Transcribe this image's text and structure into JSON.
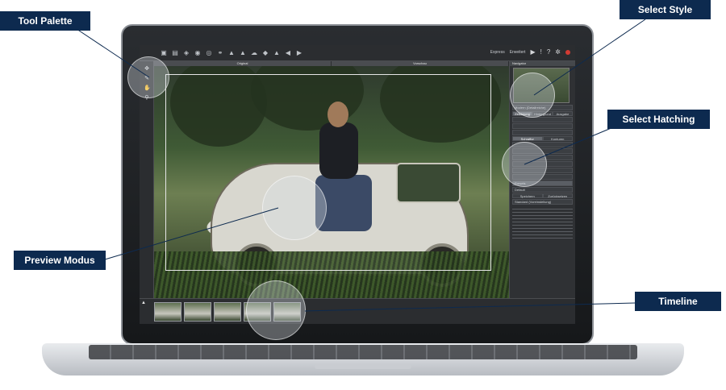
{
  "callouts": {
    "tool_palette": "Tool Palette",
    "select_style": "Select Style",
    "select_hatching": "Select  Hatching",
    "preview_modus": "Preview Modus",
    "timeline": "Timeline"
  },
  "app": {
    "toolbar": {
      "express_label": "Express",
      "erweitert_label": "Erweitert"
    },
    "tabs": [
      "Original",
      "Vorschau"
    ],
    "right_panel": {
      "navigator_label": "Navigator",
      "style_value": "Modern (Detailreiche)",
      "style_tabs": [
        "Zeichnung",
        "Hintergrund",
        "Ausgabe"
      ],
      "hatching_tabs": [
        "Schraffur",
        "Konturen"
      ],
      "presets_label": "Presets",
      "preset_value": "Default",
      "save_label": "Speichern",
      "reset_label": "Zurücksetzen",
      "section_label": "Standard (Voreinstellung)"
    }
  },
  "colors": {
    "callout_bg": "#0d2a4f",
    "callout_text": "#ffffff",
    "record_dot": "#d23b33"
  }
}
